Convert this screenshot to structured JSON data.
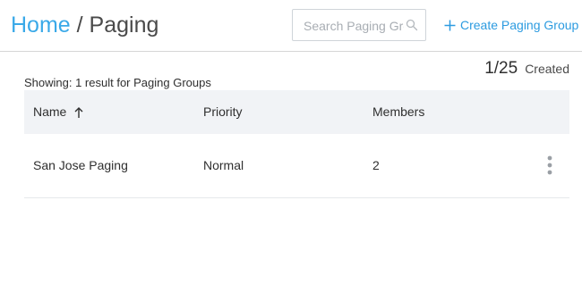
{
  "breadcrumb": {
    "home": "Home",
    "separator": " / ",
    "current": "Paging"
  },
  "search": {
    "placeholder": "Search Paging Groups",
    "value": "",
    "icon": "search-icon"
  },
  "toolbar": {
    "create_label": "Create Paging Group",
    "create_icon": "plus-icon"
  },
  "summary": {
    "count": "1/25",
    "count_label": "Created",
    "result_text": "Showing: 1 result for Paging Groups"
  },
  "table": {
    "headers": {
      "name": "Name",
      "priority": "Priority",
      "members": "Members"
    },
    "sort": {
      "column": "name",
      "direction": "ascending",
      "icon": "arrow-up-icon"
    },
    "rows": [
      {
        "name": "San Jose Paging",
        "priority": "Normal",
        "members": "2",
        "menu_icon": "more-vertical-icon"
      }
    ]
  },
  "colors": {
    "accent": "#2c9be0",
    "breadcrumb_link": "#3aa9e8",
    "header_bg": "#f1f3f6"
  }
}
